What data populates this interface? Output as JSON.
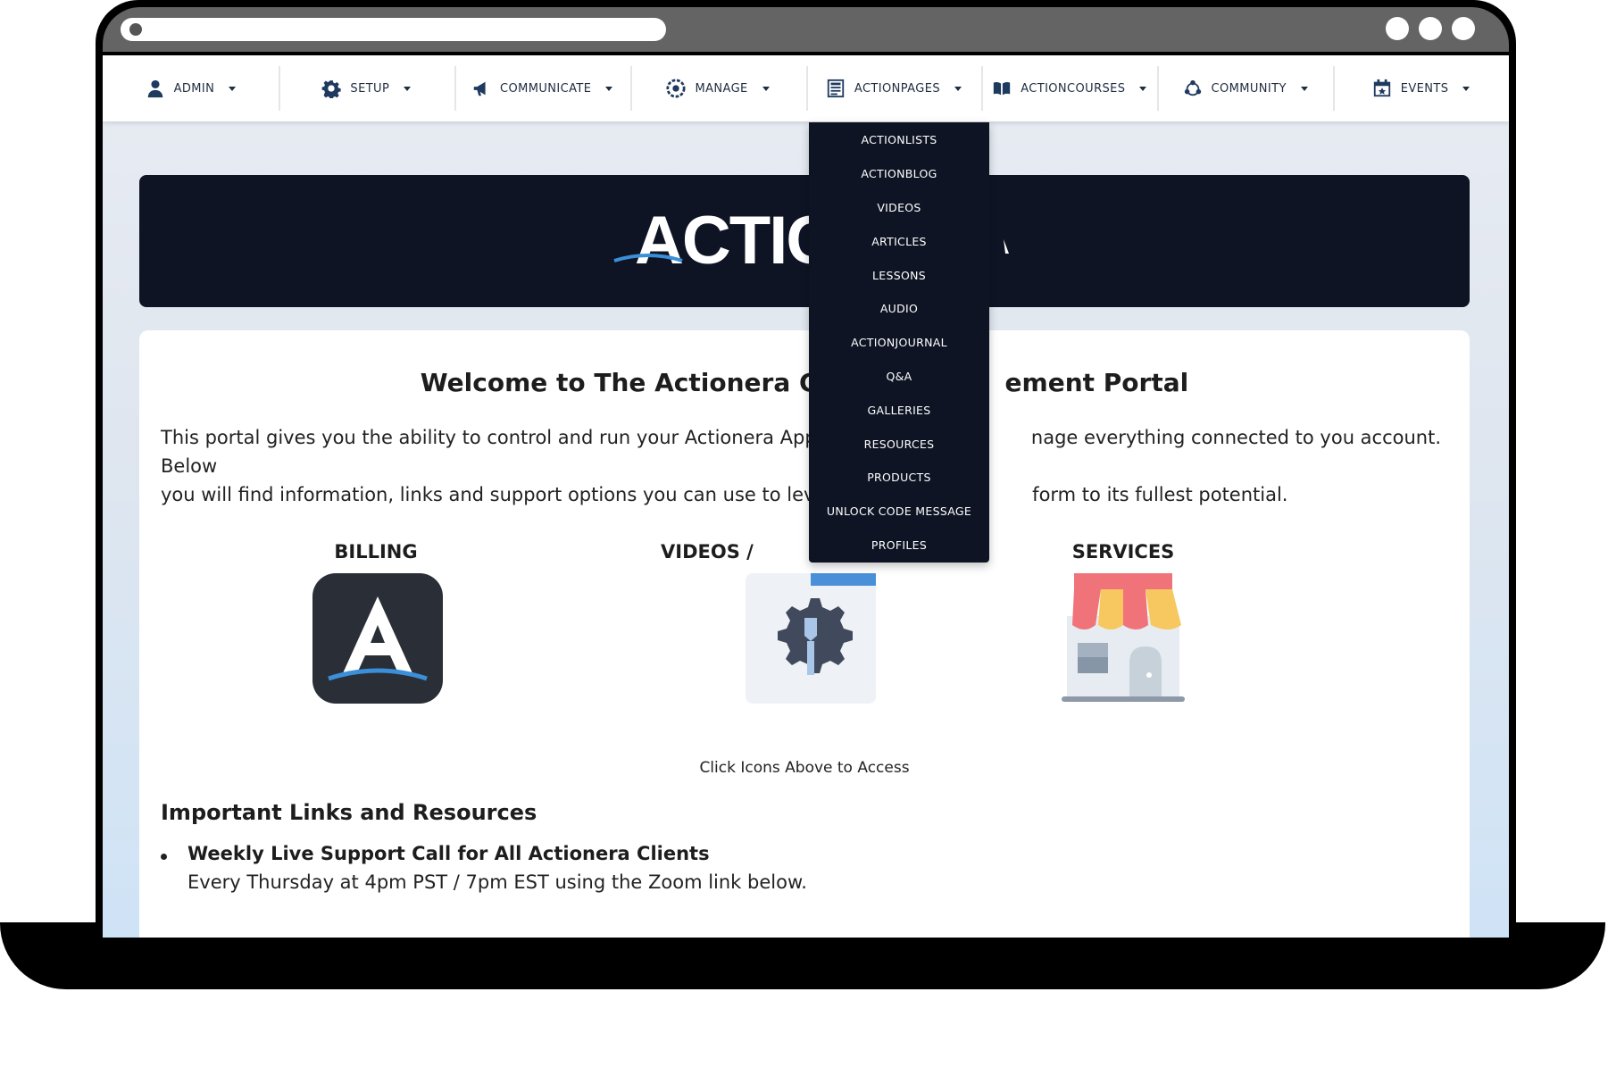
{
  "nav": {
    "items": [
      {
        "label": "ADMIN",
        "icon": "user-icon"
      },
      {
        "label": "SETUP",
        "icon": "gear-icon"
      },
      {
        "label": "COMMUNICATE",
        "icon": "megaphone-icon"
      },
      {
        "label": "MANAGE",
        "icon": "cog-circle-icon"
      },
      {
        "label": "ACTIONPAGES",
        "icon": "page-icon"
      },
      {
        "label": "ACTIONCOURSES",
        "icon": "book-icon"
      },
      {
        "label": "COMMUNITY",
        "icon": "community-icon"
      },
      {
        "label": "EVENTS",
        "icon": "calendar-icon"
      }
    ]
  },
  "dropdown": {
    "items": [
      "ACTIONLISTS",
      "ACTIONBLOG",
      "VIDEOS",
      "ARTICLES",
      "LESSONS",
      "AUDIO",
      "ACTIONJOURNAL",
      "Q&A",
      "GALLERIES",
      "RESOURCES",
      "PRODUCTS",
      "UNLOCK CODE MESSAGE",
      "PROFILES"
    ]
  },
  "banner": {
    "logo_text": "ACTIC"
  },
  "main": {
    "welcome_left": "Welcome to The Actionera C",
    "welcome_right": "ement Portal",
    "intro_l1_left": "This portal gives you the ability to control and run your Actionera App and",
    "intro_l1_right": "nage everything connected to you account. Below",
    "intro_l2_left": "you will find information, links and support options you can use to leverag",
    "intro_l2_right": "form to its fullest potential.",
    "tiles": [
      {
        "title": "BILLING",
        "icon": "actionera-logo-icon"
      },
      {
        "title": "VIDEOS /",
        "icon": "wrench-gear-icon"
      },
      {
        "title": "SERVICES",
        "icon": "storefront-icon"
      }
    ],
    "click_hint": "Click Icons Above to Access",
    "links_title": "Important Links and Resources",
    "bullet_head": "Weekly Live Support Call for All Actionera Clients",
    "bullet_sub": "Every Thursday at 4pm PST / 7pm EST using the Zoom link below."
  },
  "colors": {
    "nav_text": "#1f2d40",
    "dark_navy": "#0e1424",
    "accent_blue": "#3a8fd8"
  }
}
